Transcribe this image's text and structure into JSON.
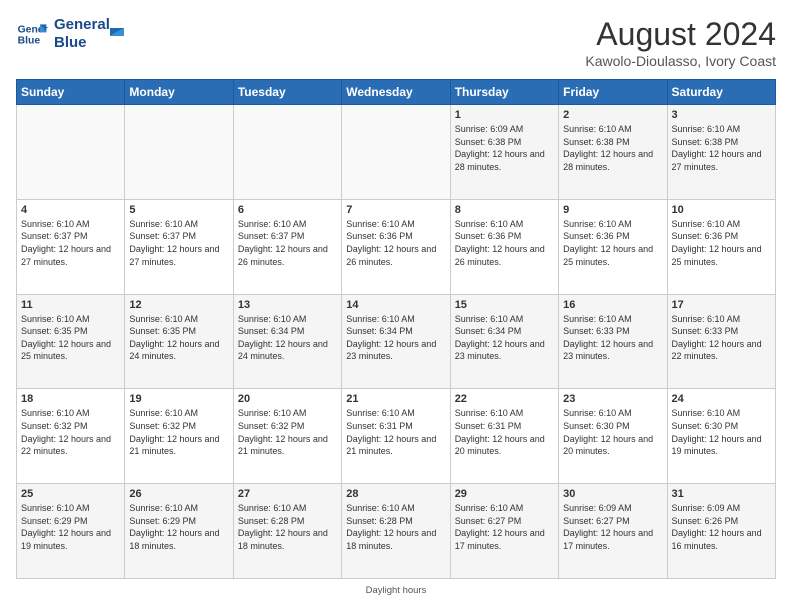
{
  "logo": {
    "line1": "General",
    "line2": "Blue"
  },
  "title": "August 2024",
  "subtitle": "Kawolo-Dioulasso, Ivory Coast",
  "days_of_week": [
    "Sunday",
    "Monday",
    "Tuesday",
    "Wednesday",
    "Thursday",
    "Friday",
    "Saturday"
  ],
  "weeks": [
    [
      {
        "day": "",
        "info": ""
      },
      {
        "day": "",
        "info": ""
      },
      {
        "day": "",
        "info": ""
      },
      {
        "day": "",
        "info": ""
      },
      {
        "day": "1",
        "info": "Sunrise: 6:09 AM\nSunset: 6:38 PM\nDaylight: 12 hours\nand 28 minutes."
      },
      {
        "day": "2",
        "info": "Sunrise: 6:10 AM\nSunset: 6:38 PM\nDaylight: 12 hours\nand 28 minutes."
      },
      {
        "day": "3",
        "info": "Sunrise: 6:10 AM\nSunset: 6:38 PM\nDaylight: 12 hours\nand 27 minutes."
      }
    ],
    [
      {
        "day": "4",
        "info": "Sunrise: 6:10 AM\nSunset: 6:37 PM\nDaylight: 12 hours\nand 27 minutes."
      },
      {
        "day": "5",
        "info": "Sunrise: 6:10 AM\nSunset: 6:37 PM\nDaylight: 12 hours\nand 27 minutes."
      },
      {
        "day": "6",
        "info": "Sunrise: 6:10 AM\nSunset: 6:37 PM\nDaylight: 12 hours\nand 26 minutes."
      },
      {
        "day": "7",
        "info": "Sunrise: 6:10 AM\nSunset: 6:36 PM\nDaylight: 12 hours\nand 26 minutes."
      },
      {
        "day": "8",
        "info": "Sunrise: 6:10 AM\nSunset: 6:36 PM\nDaylight: 12 hours\nand 26 minutes."
      },
      {
        "day": "9",
        "info": "Sunrise: 6:10 AM\nSunset: 6:36 PM\nDaylight: 12 hours\nand 25 minutes."
      },
      {
        "day": "10",
        "info": "Sunrise: 6:10 AM\nSunset: 6:36 PM\nDaylight: 12 hours\nand 25 minutes."
      }
    ],
    [
      {
        "day": "11",
        "info": "Sunrise: 6:10 AM\nSunset: 6:35 PM\nDaylight: 12 hours\nand 25 minutes."
      },
      {
        "day": "12",
        "info": "Sunrise: 6:10 AM\nSunset: 6:35 PM\nDaylight: 12 hours\nand 24 minutes."
      },
      {
        "day": "13",
        "info": "Sunrise: 6:10 AM\nSunset: 6:34 PM\nDaylight: 12 hours\nand 24 minutes."
      },
      {
        "day": "14",
        "info": "Sunrise: 6:10 AM\nSunset: 6:34 PM\nDaylight: 12 hours\nand 23 minutes."
      },
      {
        "day": "15",
        "info": "Sunrise: 6:10 AM\nSunset: 6:34 PM\nDaylight: 12 hours\nand 23 minutes."
      },
      {
        "day": "16",
        "info": "Sunrise: 6:10 AM\nSunset: 6:33 PM\nDaylight: 12 hours\nand 23 minutes."
      },
      {
        "day": "17",
        "info": "Sunrise: 6:10 AM\nSunset: 6:33 PM\nDaylight: 12 hours\nand 22 minutes."
      }
    ],
    [
      {
        "day": "18",
        "info": "Sunrise: 6:10 AM\nSunset: 6:32 PM\nDaylight: 12 hours\nand 22 minutes."
      },
      {
        "day": "19",
        "info": "Sunrise: 6:10 AM\nSunset: 6:32 PM\nDaylight: 12 hours\nand 21 minutes."
      },
      {
        "day": "20",
        "info": "Sunrise: 6:10 AM\nSunset: 6:32 PM\nDaylight: 12 hours\nand 21 minutes."
      },
      {
        "day": "21",
        "info": "Sunrise: 6:10 AM\nSunset: 6:31 PM\nDaylight: 12 hours\nand 21 minutes."
      },
      {
        "day": "22",
        "info": "Sunrise: 6:10 AM\nSunset: 6:31 PM\nDaylight: 12 hours\nand 20 minutes."
      },
      {
        "day": "23",
        "info": "Sunrise: 6:10 AM\nSunset: 6:30 PM\nDaylight: 12 hours\nand 20 minutes."
      },
      {
        "day": "24",
        "info": "Sunrise: 6:10 AM\nSunset: 6:30 PM\nDaylight: 12 hours\nand 19 minutes."
      }
    ],
    [
      {
        "day": "25",
        "info": "Sunrise: 6:10 AM\nSunset: 6:29 PM\nDaylight: 12 hours\nand 19 minutes."
      },
      {
        "day": "26",
        "info": "Sunrise: 6:10 AM\nSunset: 6:29 PM\nDaylight: 12 hours\nand 18 minutes."
      },
      {
        "day": "27",
        "info": "Sunrise: 6:10 AM\nSunset: 6:28 PM\nDaylight: 12 hours\nand 18 minutes."
      },
      {
        "day": "28",
        "info": "Sunrise: 6:10 AM\nSunset: 6:28 PM\nDaylight: 12 hours\nand 18 minutes."
      },
      {
        "day": "29",
        "info": "Sunrise: 6:10 AM\nSunset: 6:27 PM\nDaylight: 12 hours\nand 17 minutes."
      },
      {
        "day": "30",
        "info": "Sunrise: 6:09 AM\nSunset: 6:27 PM\nDaylight: 12 hours\nand 17 minutes."
      },
      {
        "day": "31",
        "info": "Sunrise: 6:09 AM\nSunset: 6:26 PM\nDaylight: 12 hours\nand 16 minutes."
      }
    ]
  ],
  "daylight_note": "Daylight hours"
}
